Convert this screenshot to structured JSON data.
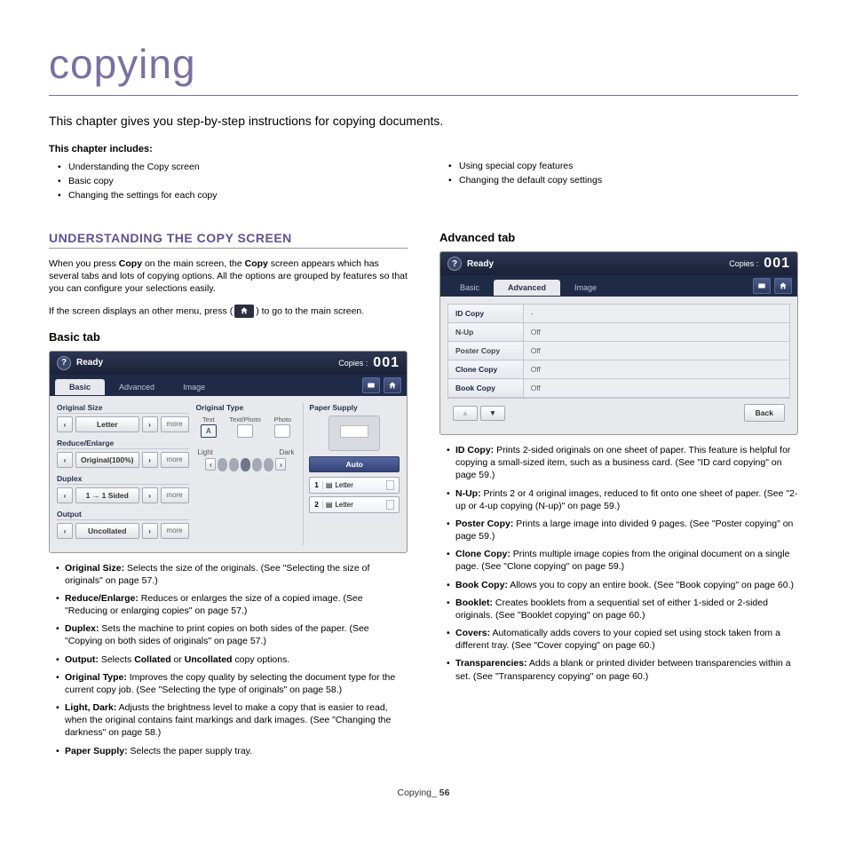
{
  "page_title": "copying",
  "intro": "This chapter gives you step-by-step instructions for copying documents.",
  "chapter_includes_title": "This chapter includes:",
  "chapter_includes_left": [
    "Understanding the Copy screen",
    "Basic copy",
    "Changing the settings for each copy"
  ],
  "chapter_includes_right": [
    "Using special copy features",
    "Changing the default copy settings"
  ],
  "section1": {
    "heading": "UNDERSTANDING THE COPY SCREEN",
    "p1a": "When you press ",
    "p1b": "Copy",
    "p1c": " on the main screen, the ",
    "p1d": "Copy",
    "p1e": " screen appears which has several tabs and lots of copying options. All the options are grouped by features so that you can configure your selections easily.",
    "p2a": "If the screen displays an other menu, press (",
    "p2b": ") to go to the main screen."
  },
  "basic": {
    "heading": "Basic tab",
    "items": [
      {
        "b": "Original Size:",
        "t": "  Selects the size of the originals. (See \"Selecting the size of originals\" on page 57.)"
      },
      {
        "b": "Reduce/Enlarge:",
        "t": "  Reduces or enlarges the size of a copied image. (See \"Reducing or enlarging copies\" on page 57.)"
      },
      {
        "b": "Duplex:",
        "t": "  Sets the machine to print copies on both sides of the paper. (See \"Copying on both sides of originals\" on page 57.)"
      },
      {
        "b": "Output:",
        "t": "  Selects Collated or Uncollated copy options."
      },
      {
        "b": "Original Type:",
        "t": "  Improves the copy quality by selecting the document type for the current copy job. (See \"Selecting the type of originals\" on page 58.)"
      },
      {
        "b": "Light, Dark:",
        "t": "  Adjusts the brightness level to make a copy that is easier to read, when the original contains faint markings and dark images. (See \"Changing the darkness\" on page 58.)"
      },
      {
        "b": "Paper Supply:",
        "t": "  Selects the paper supply tray."
      }
    ]
  },
  "advanced": {
    "heading": "Advanced tab",
    "items": [
      {
        "b": "ID Copy:",
        "t": "  Prints 2-sided originals on one sheet of paper. This feature is helpful for copying a small-sized item, such as a business card. (See \"ID card copying\" on page 59.)"
      },
      {
        "b": "N-Up:",
        "t": "  Prints 2 or 4 original images, reduced to fit onto one sheet of paper. (See \"2-up or 4-up copying (N-up)\" on page 59.)"
      },
      {
        "b": "Poster Copy:",
        "t": "  Prints a large image into divided 9 pages. (See \"Poster copying\" on page 59.)"
      },
      {
        "b": "Clone Copy:",
        "t": "  Prints multiple image copies from the original document on a single page. (See \"Clone copying\" on page 59.)"
      },
      {
        "b": "Book Copy:",
        "t": "  Allows you to copy an entire book. (See \"Book copying\" on page 60.)"
      },
      {
        "b": "Booklet:",
        "t": "  Creates booklets from a sequential set of either 1-sided or 2-sided originals. (See \"Booklet copying\" on page 60.)"
      },
      {
        "b": "Covers:",
        "t": "  Automatically adds covers to your copied set using stock taken from a different tray. (See \"Cover copying\" on page 60.)"
      },
      {
        "b": "Transparencies:",
        "t": "  Adds a blank or printed divider between transparencies within a set. (See \"Transparency copying\" on page 60.)"
      }
    ]
  },
  "cs": {
    "ready": "Ready",
    "copies_label": "Copies :",
    "copies_value": "001",
    "tabs": {
      "basic": "Basic",
      "advanced": "Advanced",
      "image": "Image"
    },
    "groups": {
      "original_size": "Original Size",
      "reduce_enlarge": "Reduce/Enlarge",
      "duplex": "Duplex",
      "output": "Output",
      "original_type": "Original Type",
      "paper_supply": "Paper Supply"
    },
    "values": {
      "letter": "Letter",
      "original100": "Original(100%)",
      "duplex": "1 → 1 Sided",
      "uncollated": "Uncollated",
      "more": "more"
    },
    "types": {
      "text": "Text",
      "textphoto": "Text/Photo",
      "photo": "Photo",
      "a": "A"
    },
    "light": "Light",
    "dark": "Dark",
    "auto": "Auto",
    "tray1": "Letter",
    "tray2": "Letter",
    "tray1_num": "1",
    "tray2_num": "2",
    "back": "Back",
    "adv": [
      {
        "k": "ID Copy",
        "v": "-",
        "active": true
      },
      {
        "k": "N-Up",
        "v": "Off",
        "active": false
      },
      {
        "k": "Poster Copy",
        "v": "Off",
        "active": false
      },
      {
        "k": "Clone Copy",
        "v": "Off",
        "active": true
      },
      {
        "k": "Book Copy",
        "v": "Off",
        "active": true
      }
    ]
  },
  "output_note_b1": "Collated",
  "output_note_b2": "Uncollated",
  "footer": {
    "label": "Copying",
    "sep": "_ ",
    "page": "56"
  }
}
